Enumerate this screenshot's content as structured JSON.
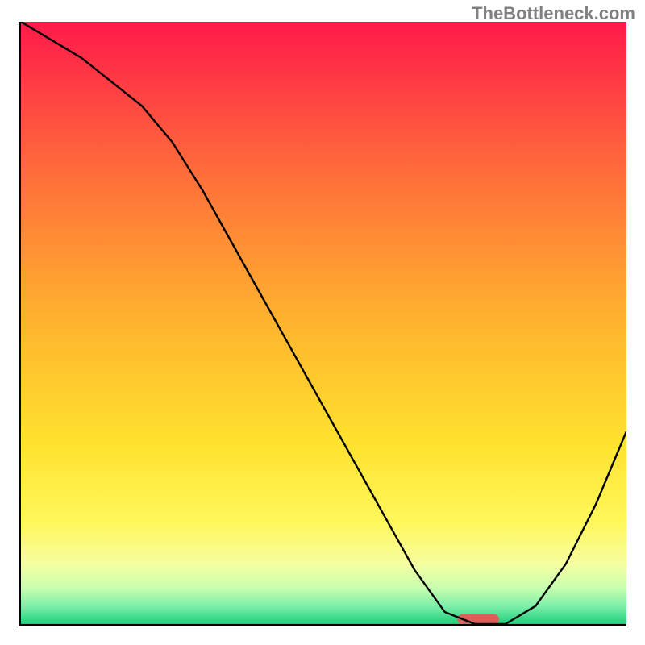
{
  "watermark": "TheBottleneck.com",
  "chart_data": {
    "type": "line",
    "title": "",
    "xlabel": "",
    "ylabel": "",
    "x_range": [
      0,
      100
    ],
    "y_range": [
      0,
      100
    ],
    "series": [
      {
        "name": "bottleneck-curve",
        "x": [
          0,
          5,
          10,
          15,
          20,
          25,
          30,
          35,
          40,
          45,
          50,
          55,
          60,
          65,
          70,
          75,
          80,
          85,
          90,
          95,
          100
        ],
        "y": [
          100,
          97,
          94,
          90,
          86,
          80,
          72,
          63,
          54,
          45,
          36,
          27,
          18,
          9,
          2,
          0,
          0,
          3,
          10,
          20,
          32
        ]
      }
    ],
    "optimal_marker": {
      "x_start": 72,
      "x_end": 79,
      "y": 0
    },
    "gradient_stops": [
      {
        "offset": 0.0,
        "color": "#ff1a4a"
      },
      {
        "offset": 0.25,
        "color": "#ff6d3a"
      },
      {
        "offset": 0.5,
        "color": "#ffb42e"
      },
      {
        "offset": 0.7,
        "color": "#ffe22e"
      },
      {
        "offset": 0.83,
        "color": "#fff75a"
      },
      {
        "offset": 0.9,
        "color": "#f6ffa0"
      },
      {
        "offset": 0.94,
        "color": "#c8ffb0"
      },
      {
        "offset": 0.97,
        "color": "#7eefa8"
      },
      {
        "offset": 1.0,
        "color": "#1ccf7a"
      }
    ]
  }
}
